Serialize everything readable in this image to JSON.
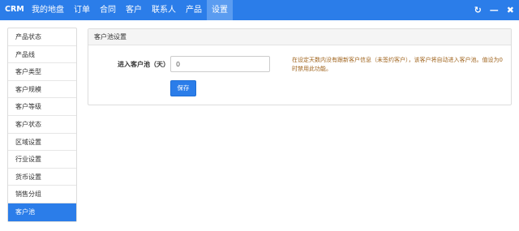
{
  "header": {
    "brand": "CRM",
    "nav": [
      {
        "label": "我的地盘"
      },
      {
        "label": "订单"
      },
      {
        "label": "合同"
      },
      {
        "label": "客户"
      },
      {
        "label": "联系人"
      },
      {
        "label": "产品"
      },
      {
        "label": "设置",
        "active": true
      }
    ],
    "controls": {
      "refresh": "↻",
      "minimize": "—",
      "close": "✖"
    }
  },
  "sidebar": {
    "items": [
      {
        "label": "产品状态"
      },
      {
        "label": "产品线"
      },
      {
        "label": "客户类型"
      },
      {
        "label": "客户规模"
      },
      {
        "label": "客户等级"
      },
      {
        "label": "客户状态"
      },
      {
        "label": "区域设置"
      },
      {
        "label": "行业设置"
      },
      {
        "label": "货币设置"
      },
      {
        "label": "销售分组"
      },
      {
        "label": "客户池",
        "active": true
      }
    ]
  },
  "panel": {
    "title": "客户池设置",
    "field_label": "进入客户池（天）",
    "field_value": "0",
    "hint": "在设定天数内没有跟新客户信息（未签约客户），该客户将自动进入客户池。值设为0时禁用此功能。",
    "save_label": "保存"
  },
  "colors": {
    "accent": "#2b7de9",
    "hint": "#a0641e"
  }
}
